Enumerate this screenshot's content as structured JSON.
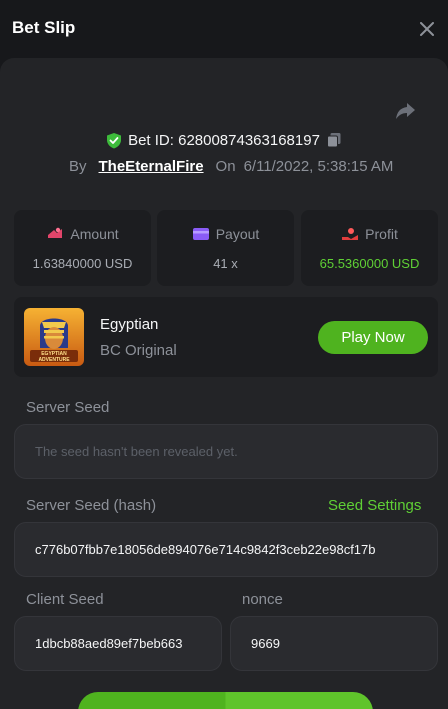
{
  "header": {
    "title": "Bet Slip"
  },
  "bet": {
    "id_label": "Bet ID: 62800874363168197",
    "by_label": "By",
    "username": "TheEternalFire",
    "on_label": "On",
    "date": "6/11/2022, 5:38:15 AM"
  },
  "stats": [
    {
      "label": "Amount",
      "value": "1.63840000 USD",
      "icon": "amount-icon",
      "color": "#e2456a"
    },
    {
      "label": "Payout",
      "value": "41 x",
      "icon": "payout-icon",
      "color": "#8a5cf6"
    },
    {
      "label": "Profit",
      "value": "65.5360000 USD",
      "icon": "profit-icon",
      "color": "#e23d3d"
    }
  ],
  "game": {
    "name": "Egyptian",
    "provider": "BC Original",
    "thumb_text": "EGYPTIAN ADVENTURE",
    "play_label": "Play Now"
  },
  "seeds": {
    "server_seed_label": "Server Seed",
    "server_seed_value": "The seed hasn't been revealed yet.",
    "server_hash_label": "Server Seed (hash)",
    "seed_settings_label": "Seed Settings",
    "server_hash_value": "c776b07fbb7e18056de894076e714c9842f3ceb22e98cf17b",
    "client_seed_label": "Client Seed",
    "client_seed_value": "1dbcb88aed89ef7beb663",
    "nonce_label": "nonce",
    "nonce_value": "9669"
  },
  "colors": {
    "accent": "#5fd035",
    "button": "#4fb31f",
    "shield": "#3dbb3b"
  }
}
